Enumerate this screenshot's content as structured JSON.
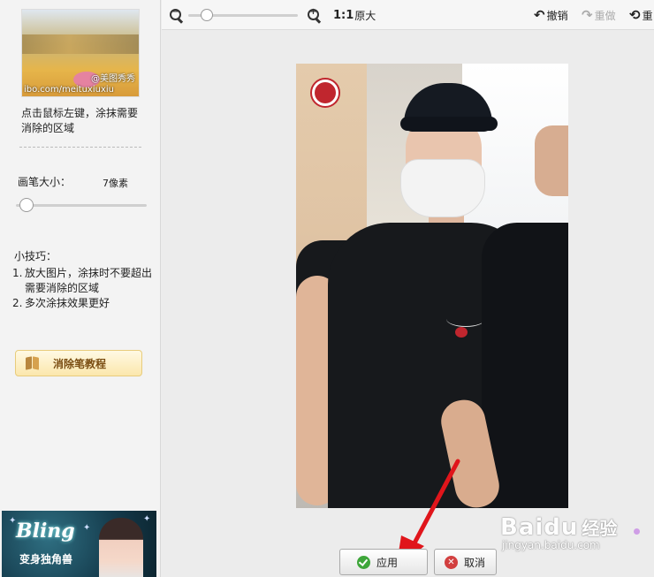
{
  "left_panel": {
    "thumbnail_watermark": "@美图秀秀",
    "thumbnail_url": "ibo.com/meituxiuxiu",
    "hint": "点击鼠标左键，涂抹需要消除的区域",
    "brush_label": "画笔大小：",
    "brush_value": "7像素",
    "brush_size_px": 7,
    "tips_title": "小技巧：",
    "tips": [
      {
        "num": "1.",
        "text": "放大图片，涂抹时不要超出需要消除的区域"
      },
      {
        "num": "2.",
        "text": "多次涂抹效果更好"
      }
    ],
    "tutorial_button": "消除笔教程",
    "ad": {
      "title": "Bling",
      "subtitle": "变身独角兽"
    }
  },
  "toolbar": {
    "zoom_out_icon": "zoom-out-icon",
    "zoom_in_icon": "zoom-in-icon",
    "original_prefix": "1:1",
    "original_label": "原大",
    "undo_label": "撤销",
    "redo_label": "重做",
    "reset_label": "重"
  },
  "footer": {
    "apply_label": "应用",
    "cancel_label": "取消"
  },
  "watermark": {
    "brand": "Baidu",
    "brand_cn": "经验",
    "url": "jingyan.baidu.com"
  },
  "colors": {
    "apply_icon": "#3ea63a",
    "cancel_icon": "#d23f3f",
    "arrow": "#e0151b",
    "tutorial_bg": "#fbe7ac"
  }
}
